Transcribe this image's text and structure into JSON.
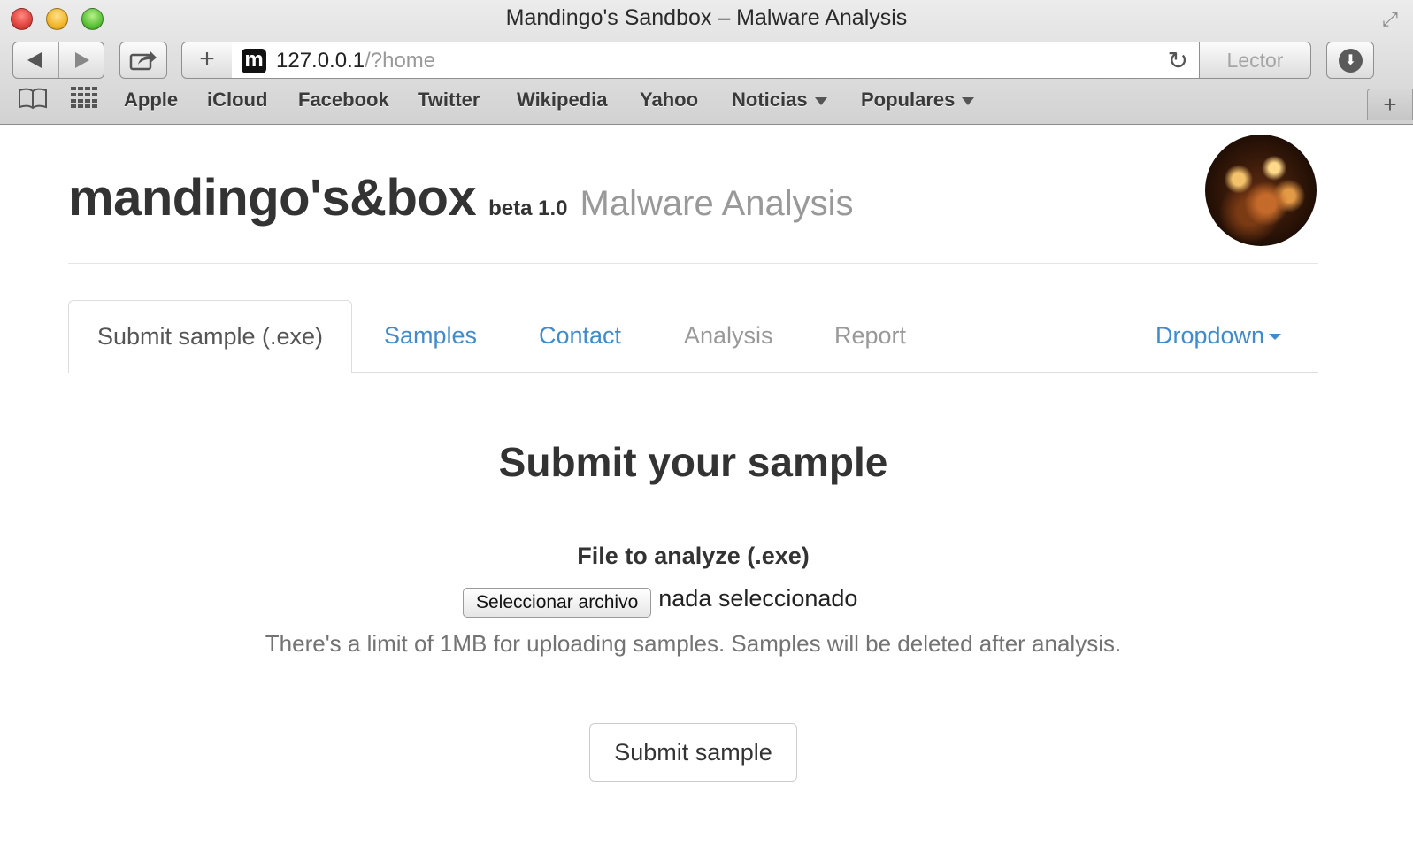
{
  "browser": {
    "window_title": "Mandingo's Sandbox – Malware Analysis",
    "url_host": "127.0.0.1",
    "url_path": "/?home",
    "favicon_letter": "m",
    "reader_label": "Lector",
    "bookmarks": [
      "Apple",
      "iCloud",
      "Facebook",
      "Twitter",
      "Wikipedia",
      "Yahoo",
      "Noticias",
      "Populares"
    ],
    "icons": {
      "back": "back-arrow-icon",
      "forward": "forward-arrow-icon",
      "share": "share-icon",
      "new_tab": "plus-icon",
      "reload": "reload-icon",
      "downloads": "download-icon",
      "reading_list": "book-icon",
      "top_sites": "grid-icon",
      "fullscreen": "fullscreen-icon"
    }
  },
  "header": {
    "brand": "mandingo's&box",
    "version": "beta 1.0",
    "tagline": "Malware Analysis"
  },
  "tabs": [
    {
      "label": "Submit sample (.exe)",
      "state": "active"
    },
    {
      "label": "Samples",
      "state": "link"
    },
    {
      "label": "Contact",
      "state": "link"
    },
    {
      "label": "Analysis",
      "state": "disabled"
    },
    {
      "label": "Report",
      "state": "disabled"
    },
    {
      "label": "Dropdown",
      "state": "dropdown"
    }
  ],
  "form": {
    "heading": "Submit your sample",
    "field_label": "File to analyze (.exe)",
    "file_button": "Seleccionar archivo",
    "file_status": "nada seleccionado",
    "help_text": "There's a limit of 1MB for uploading samples. Samples will be deleted after analysis.",
    "submit_label": "Submit sample"
  },
  "colors": {
    "link": "#428bca",
    "muted": "#999999",
    "text": "#333333"
  }
}
